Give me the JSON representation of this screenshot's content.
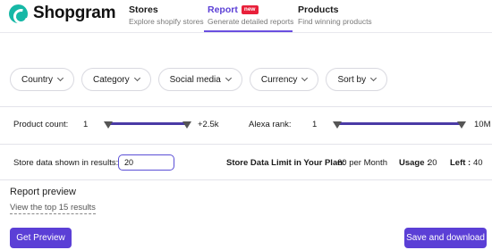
{
  "brand": {
    "name": "Shopgram"
  },
  "nav": [
    {
      "title": "Stores",
      "subtitle": "Explore shopify stores"
    },
    {
      "title": "Report",
      "badge": "new",
      "subtitle": "Generate detailed reports"
    },
    {
      "title": "Products",
      "subtitle": "Find winning products"
    }
  ],
  "filters": [
    "Country",
    "Category",
    "Social media",
    "Currency",
    "Sort by"
  ],
  "product_count": {
    "label": "Product count:",
    "min": "1",
    "max": "+2.5k"
  },
  "alexa_rank": {
    "label": "Alexa rank:",
    "min": "1",
    "max": "10M"
  },
  "results": {
    "label": "Store data shown in results:",
    "value": "20"
  },
  "plan": {
    "limit_label": "Store Data Limit in Your Plan:",
    "limit_value": "60 per Month",
    "usage_label": "Usage :",
    "usage_value": "20",
    "left_label": "Left :",
    "left_value": "40"
  },
  "preview": {
    "title": "Report preview",
    "link": "View the top 15 results"
  },
  "buttons": {
    "get_preview": "Get Preview",
    "save_download": "Save and download"
  },
  "colors": {
    "accent": "#5b3fd6",
    "brand": "#16b8a6",
    "badge": "#e8203a"
  }
}
